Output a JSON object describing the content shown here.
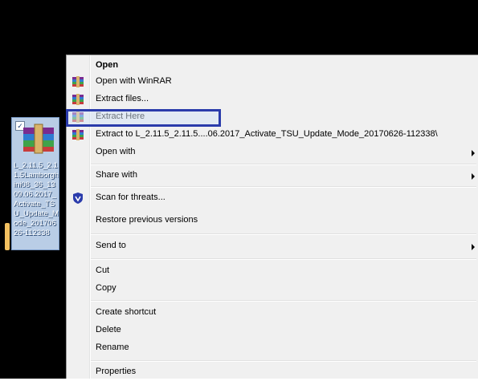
{
  "desktop": {
    "icon_label": "L_2.11.5_2.11.5Lamborghini08_36_1309.06.2017_Activate_TSU_Update_Mode_20170626-112338",
    "icon_name": "winrar-archive-icon"
  },
  "menu": {
    "items": [
      {
        "label": "Open",
        "bold": true
      },
      {
        "label": "Open with WinRAR",
        "icon": "winrar-icon"
      },
      {
        "label": "Extract files...",
        "icon": "winrar-icon"
      },
      {
        "label": "Extract Here",
        "icon": "winrar-icon"
      },
      {
        "label": "Extract to L_2.11.5_2.11.5....06.2017_Activate_TSU_Update_Mode_20170626-112338\\",
        "icon": "winrar-icon"
      },
      {
        "label": "Open with",
        "submenu": true
      },
      {
        "label": "Share with",
        "submenu": true
      },
      {
        "label": "Scan for threats...",
        "icon": "shield-icon"
      },
      {
        "label": "Restore previous versions"
      },
      {
        "label": "Send to",
        "submenu": true
      },
      {
        "label": "Cut"
      },
      {
        "label": "Copy"
      },
      {
        "label": "Create shortcut"
      },
      {
        "label": "Delete"
      },
      {
        "label": "Rename"
      },
      {
        "label": "Properties"
      }
    ]
  },
  "colors": {
    "highlight_border": "#2a3bab",
    "menu_bg": "#f0f0f0"
  }
}
